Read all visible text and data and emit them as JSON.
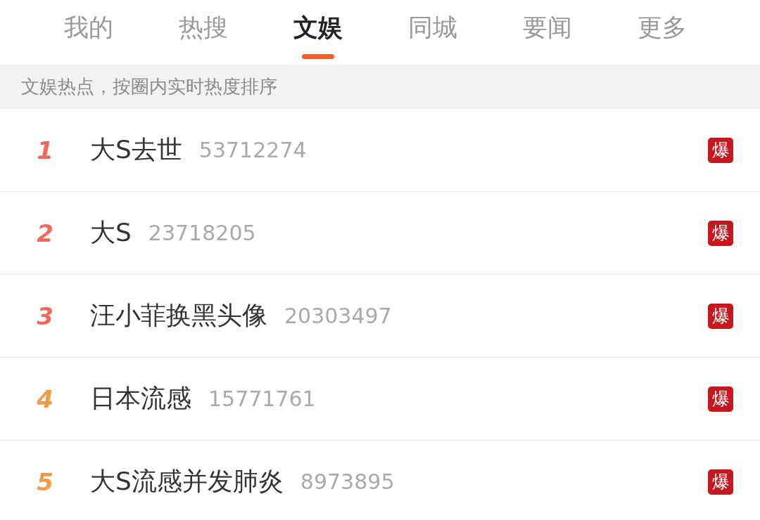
{
  "tabs": [
    {
      "label": "我的",
      "selected": false
    },
    {
      "label": "热搜",
      "selected": false
    },
    {
      "label": "文娱",
      "selected": true
    },
    {
      "label": "同城",
      "selected": false
    },
    {
      "label": "要闻",
      "selected": false
    },
    {
      "label": "更多",
      "selected": false
    }
  ],
  "notice": "文娱热点，按圈内实时热度排序",
  "items": [
    {
      "rank": "1",
      "title": "大S去世",
      "heat": "53712274",
      "badge": "爆",
      "color": "#ef6a5c"
    },
    {
      "rank": "2",
      "title": "大S",
      "heat": "23718205",
      "badge": "爆",
      "color": "#ef6a5c"
    },
    {
      "rank": "3",
      "title": "汪小菲换黑头像",
      "heat": "20303497",
      "badge": "爆",
      "color": "#ef6a5c"
    },
    {
      "rank": "4",
      "title": "日本流感",
      "heat": "15771761",
      "badge": "爆",
      "color": "#f29a45"
    },
    {
      "rank": "5",
      "title": "大S流感并发肺炎",
      "heat": "8973895",
      "badge": "爆",
      "color": "#f29a45"
    }
  ]
}
